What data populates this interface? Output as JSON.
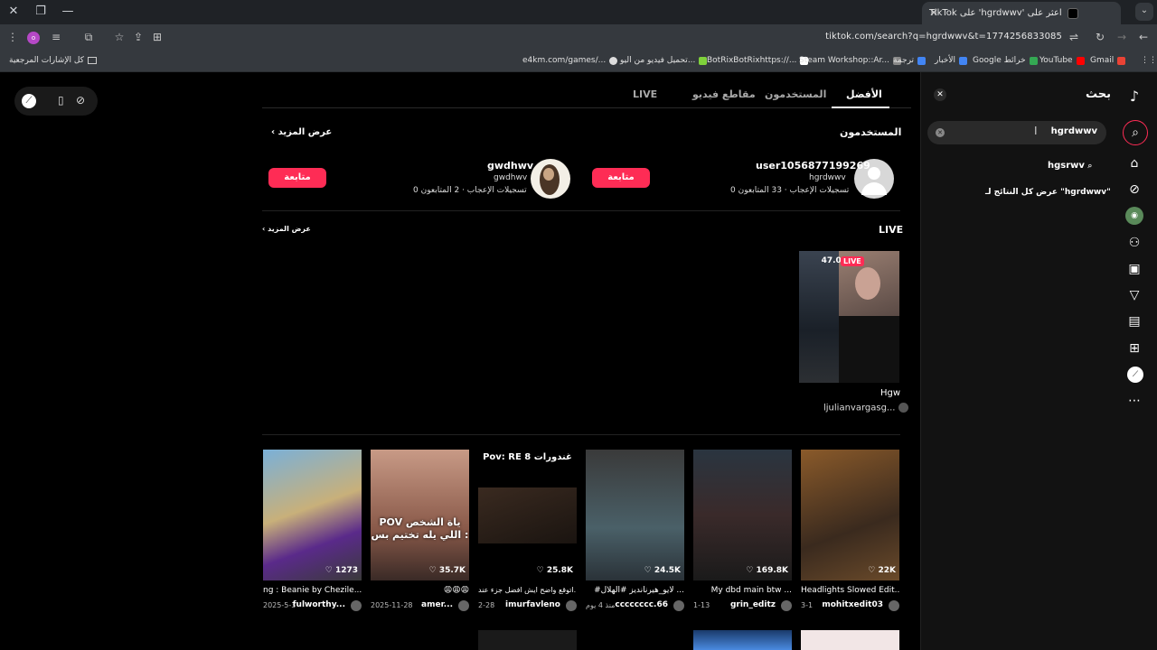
{
  "browser": {
    "tab_title": "اعثر على 'hgrdwwv' على TikTok",
    "url": "tiktok.com/search?q=hgrdwwv&t=1774256833085",
    "bookmarks": [
      {
        "label": "Gmail",
        "color": "#ea4335"
      },
      {
        "label": "YouTube",
        "color": "#ff0000"
      },
      {
        "label": "Google خرائط",
        "color": "#34a853"
      },
      {
        "label": "الأخبار",
        "color": "#4285f4"
      },
      {
        "label": "ترجمة",
        "color": "#4285f4"
      },
      {
        "label": "Steam Workshop::Ar...",
        "color": "#888888"
      },
      {
        "label": "BotRixBotRixhttps://...",
        "color": "#ffffff"
      },
      {
        "label": "تحميل فيديو من اليو...",
        "color": "#7fd13b"
      },
      {
        "label": "e4km.com/games/...",
        "color": "#dddddd"
      }
    ],
    "all_bookmarks": "كل الإشارات المرجعية"
  },
  "search_panel": {
    "title": "بحث",
    "query": "hgrdwwv",
    "suggestion": "hgsrwv",
    "view_all": "عرض كل النتائج لـ \"hgrdwwv\""
  },
  "tabs": {
    "top": "الأفضل",
    "users": "المستخدمون",
    "videos": "مقاطع فيديو",
    "live": "LIVE"
  },
  "users_section": {
    "title": "المستخدمون",
    "more": "عرض المزيد",
    "follow": "متابعة",
    "users": [
      {
        "username": "user1056877199269",
        "nickname": "hgrdwwv",
        "followers": "33 المتابعون",
        "likes": "0 تسجيلات الإعجاب"
      },
      {
        "username": "gwdhwv",
        "nickname": "gwdhwv",
        "followers": "2 المتابعون",
        "likes": "0 تسجيلات الإعجاب"
      }
    ]
  },
  "live_section": {
    "title": "LIVE",
    "more": "عرض المزيد",
    "viewers": "47.0K",
    "badge": "LIVE",
    "caption": "Hgw",
    "author": "ljulianvargasg..."
  },
  "videos": [
    {
      "count": "22K",
      "caption": "Headlights Slowed Edit...",
      "author": "mohitxedit03",
      "date": "3-1",
      "overlay": ""
    },
    {
      "count": "169.8K",
      "caption": "My dbd main btw ...",
      "author": "grin_editz",
      "date": "1-13",
      "overlay": ""
    },
    {
      "count": "24.5K",
      "caption": "#لايو_هيرناندیز #الهلال ...",
      "author": "cccccccc.66",
      "date": "منذ 4 يوم",
      "overlay": ""
    },
    {
      "count": "25.8K",
      "caption": "اتوقع واضح ايش افضل جزء عند...",
      "author": "imurfavleno",
      "date": "2-28",
      "overlay": "Pov: RE 8 غندورات"
    },
    {
      "count": "35.7K",
      "caption": "😩😩😩",
      "author": "amer...",
      "date": "2025-11-28",
      "overlay": "POV ياة الشخص اللي يله تختيم بس :"
    },
    {
      "count": "1273",
      "caption": "ng : Beanie by Chezile...",
      "author": "fulworthy...",
      "date": "2025-5-3",
      "overlay": ""
    }
  ]
}
